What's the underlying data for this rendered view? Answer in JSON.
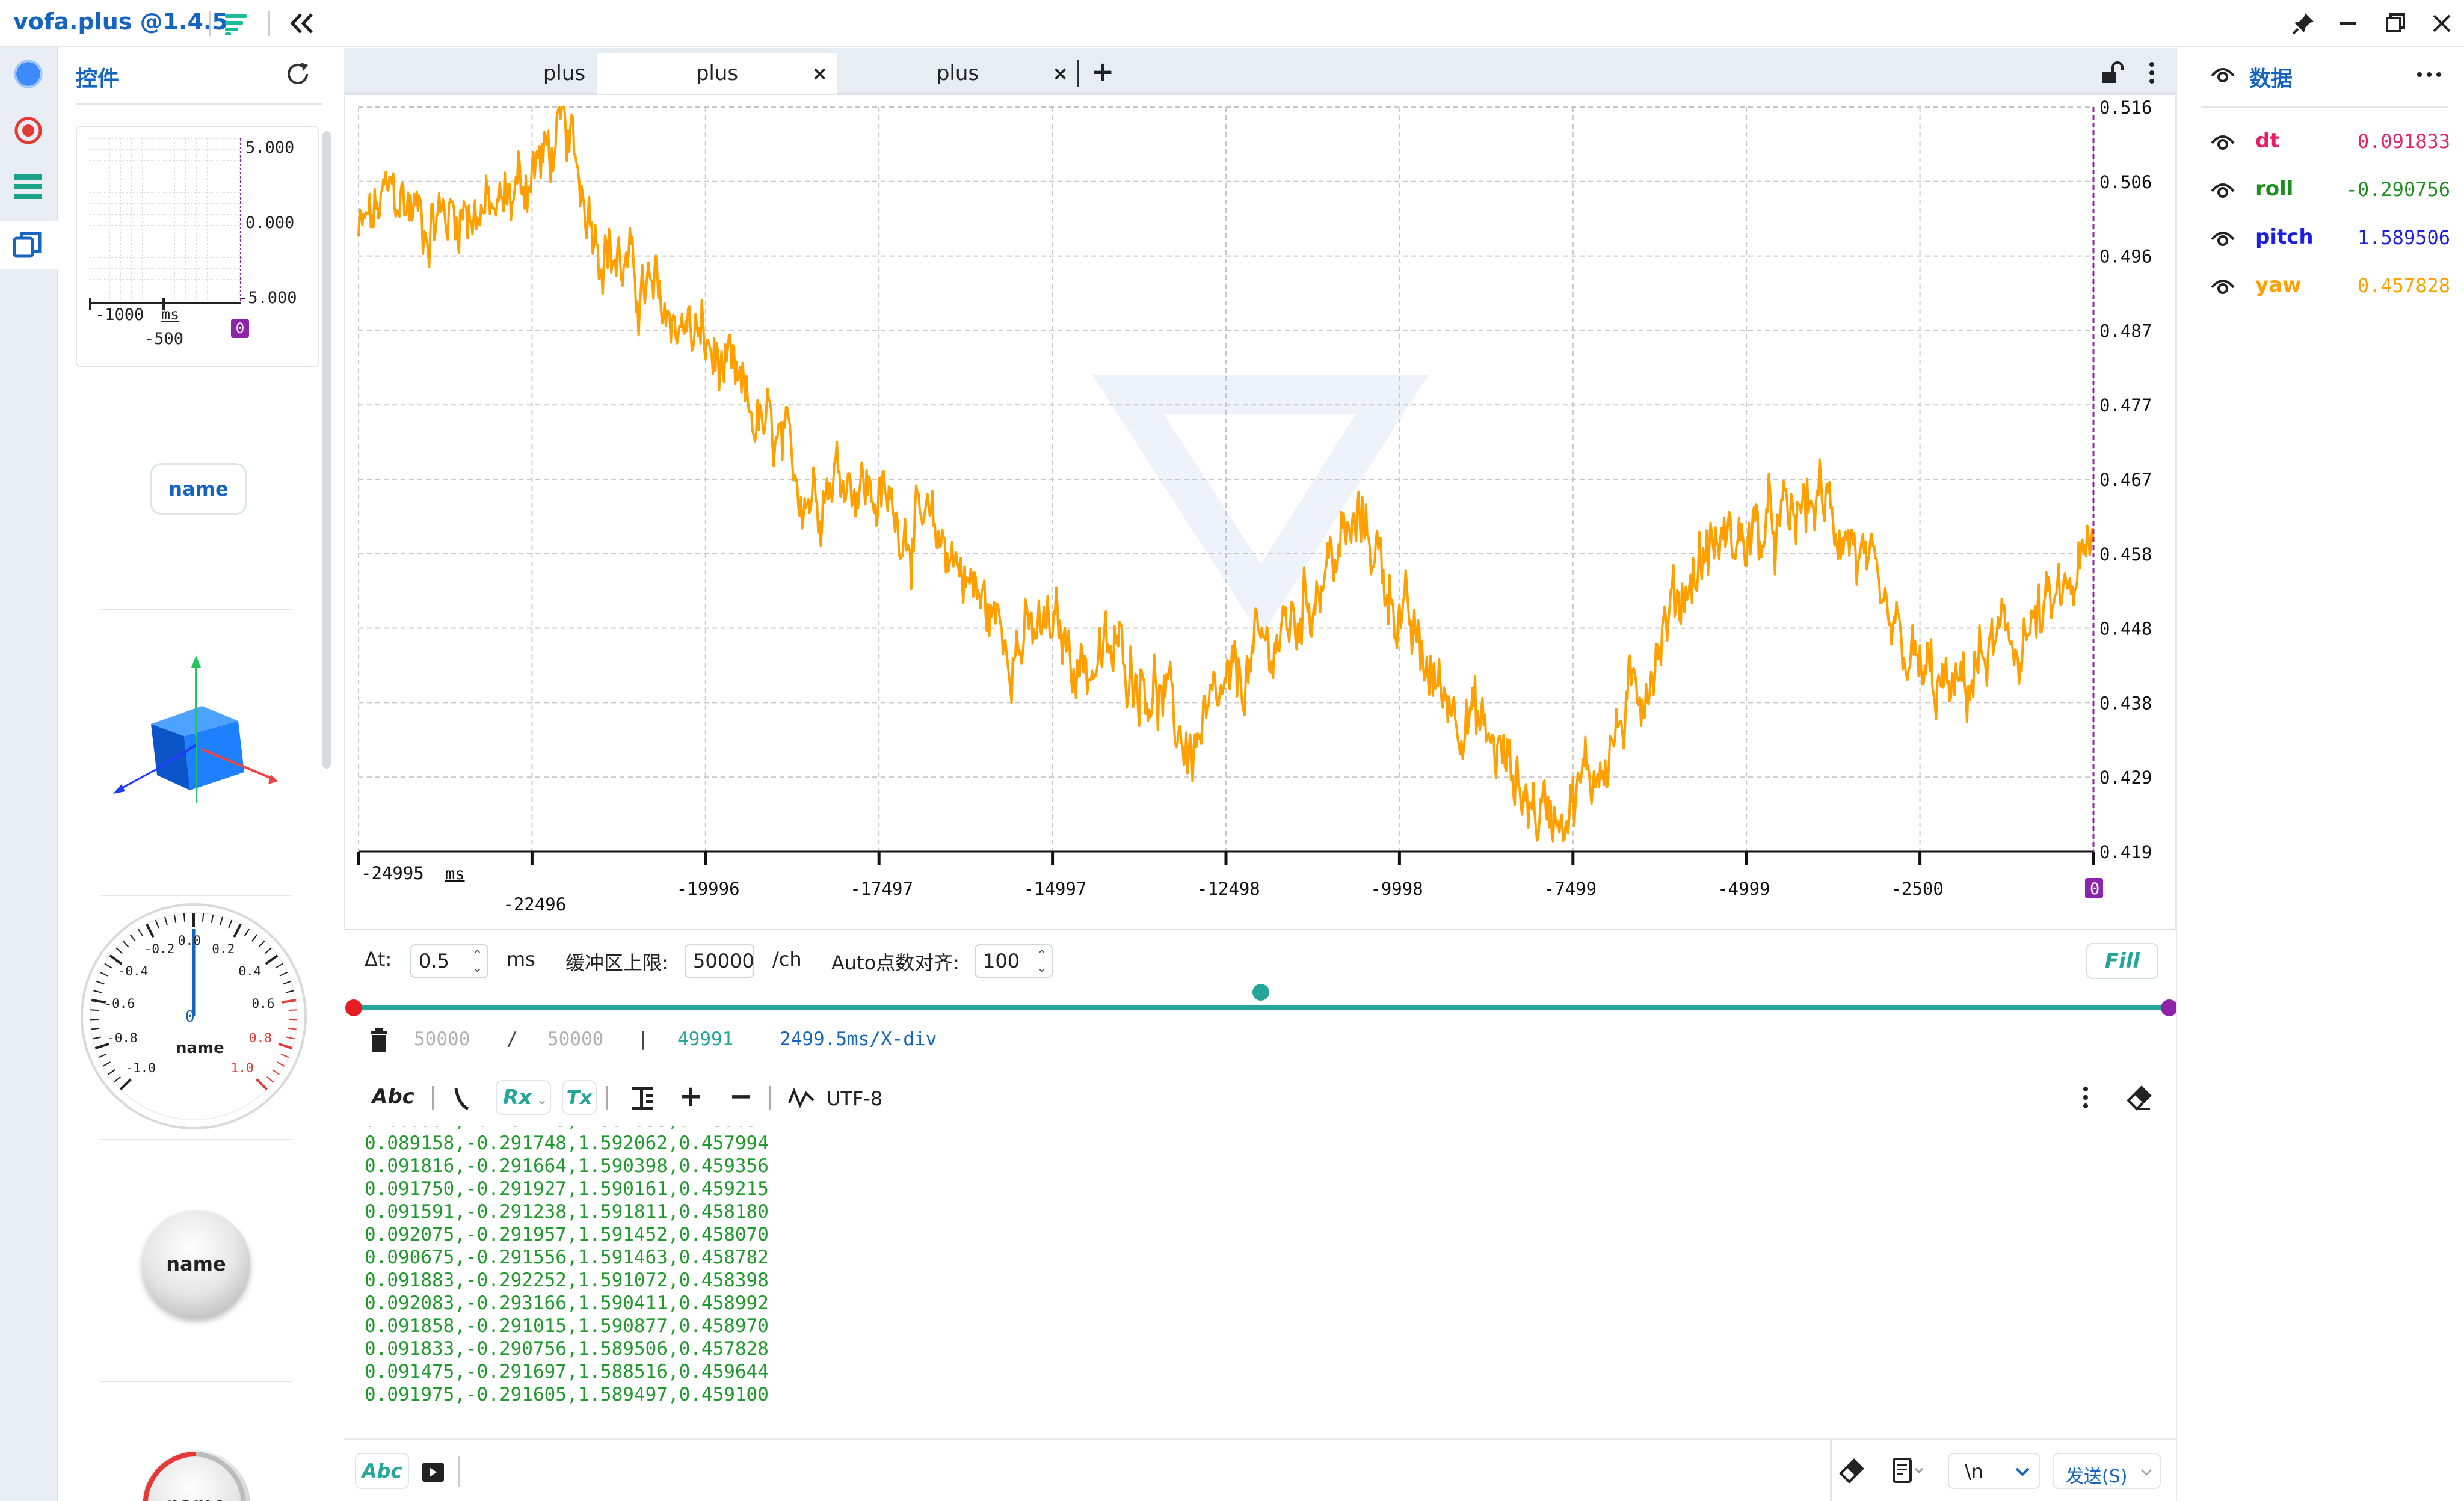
{
  "app": {
    "title": "vofa.plus @1.4.5"
  },
  "left_panel": {
    "title": "控件",
    "mini_plot": {
      "y_top": "5.000",
      "y_mid": "0.000",
      "y_bot": "-5.000",
      "x_left": "-1000",
      "x_unit": "ms",
      "x_mid": "-500",
      "marker": "0"
    },
    "name_button": "name",
    "dial": {
      "center_value": "0",
      "label": "name",
      "ticks": [
        "-1.0",
        "-0.8",
        "-0.6",
        "-0.4",
        "-0.2",
        "0.0",
        "0.2",
        "0.4",
        "0.6",
        "0.8",
        "1.0"
      ]
    },
    "knob1_label": "name",
    "knob2_label": "name"
  },
  "tabs": [
    {
      "label": "plus",
      "active": false
    },
    {
      "label": "plus",
      "active": true
    },
    {
      "label": "plus",
      "active": false
    }
  ],
  "colors": {
    "accent": "#1565c0",
    "trace": "#ffa000",
    "teal": "#26a69a",
    "purple": "#8e24aa",
    "rx_text": "#1e9a2a"
  },
  "chart_data": {
    "type": "line",
    "series": [
      {
        "name": "yaw",
        "color": "#ffa000",
        "x": [
          -24995,
          -24500,
          -24000,
          -23500,
          -23000,
          -22496,
          -22000,
          -21500,
          -21000,
          -20500,
          -19996,
          -19500,
          -19000,
          -18500,
          -17997,
          -17497,
          -17000,
          -16500,
          -15997,
          -15500,
          -14997,
          -14500,
          -13997,
          -13500,
          -12998,
          -12498,
          -12000,
          -11500,
          -10998,
          -10500,
          -9998,
          -9500,
          -9000,
          -8500,
          -7999,
          -7499,
          -7000,
          -6500,
          -5999,
          -5500,
          -4999,
          -4500,
          -4000,
          -3500,
          -3000,
          -2500,
          -2000,
          -1500,
          -1000,
          -500,
          0
        ],
        "y": [
          0.499,
          0.505,
          0.501,
          0.503,
          0.502,
          0.508,
          0.512,
          0.499,
          0.493,
          0.489,
          0.485,
          0.478,
          0.472,
          0.466,
          0.469,
          0.465,
          0.461,
          0.459,
          0.451,
          0.446,
          0.448,
          0.443,
          0.445,
          0.44,
          0.432,
          0.439,
          0.445,
          0.449,
          0.457,
          0.462,
          0.45,
          0.441,
          0.437,
          0.431,
          0.424,
          0.426,
          0.432,
          0.441,
          0.452,
          0.459,
          0.46,
          0.461,
          0.465,
          0.46,
          0.448,
          0.442,
          0.439,
          0.445,
          0.447,
          0.451,
          0.458
        ]
      }
    ],
    "x_ticks": [
      "-24995",
      "-22496",
      "-19996",
      "-17497",
      "-14997",
      "-12498",
      "-9998",
      "-7499",
      "-4999",
      "-2500",
      "0"
    ],
    "x_unit": "ms",
    "y_ticks": [
      "0.516",
      "0.506",
      "0.496",
      "0.487",
      "0.477",
      "0.467",
      "0.458",
      "0.448",
      "0.438",
      "0.429",
      "0.419"
    ],
    "xlim": [
      -24995,
      0
    ],
    "ylim": [
      0.419,
      0.516
    ],
    "grid": true
  },
  "controls": {
    "dt_label": "Δt:",
    "dt_value": "0.5",
    "dt_unit": "ms",
    "buffer_label": "缓冲区上限:",
    "buffer_value": "50000",
    "buffer_unit": "/ch",
    "auto_label": "Auto点数对齐:",
    "auto_value": "100",
    "fill_button": "Fill"
  },
  "status": {
    "count1": "50000",
    "sep1": "/",
    "count2": "50000",
    "sep2": "|",
    "count3": "49991",
    "xdiv": "2499.5ms/X-div"
  },
  "rx_toolbar": {
    "abc": "Abc",
    "rx": "Rx",
    "tx": "Tx",
    "encoding": "UTF-8"
  },
  "rx_lines": [
    "0.089158,-0.291748,1.592062,0.457994",
    "0.091816,-0.291664,1.590398,0.459356",
    "0.091750,-0.291927,1.590161,0.459215",
    "0.091591,-0.291238,1.591811,0.458180",
    "0.092075,-0.291957,1.591452,0.458070",
    "0.090675,-0.291556,1.591463,0.458782",
    "0.091883,-0.292252,1.591072,0.458398",
    "0.092083,-0.293166,1.590411,0.458992",
    "0.091858,-0.291015,1.590877,0.458970",
    "0.091833,-0.290756,1.589506,0.457828",
    "0.091475,-0.291697,1.588516,0.459644",
    "0.091975,-0.291605,1.589497,0.459100"
  ],
  "send_bar": {
    "abc": "Abc",
    "newline": "\\n",
    "send": "发送(S)"
  },
  "data_panel": {
    "title": "数据",
    "channels": [
      {
        "name": "dt",
        "value": "0.091833",
        "color": "#e91e63"
      },
      {
        "name": "roll",
        "value": "-0.290756",
        "color": "#1b8f1f"
      },
      {
        "name": "pitch",
        "value": "1.589506",
        "color": "#1e1ee0"
      },
      {
        "name": "yaw",
        "value": "0.457828",
        "color": "#ffa000"
      }
    ]
  }
}
